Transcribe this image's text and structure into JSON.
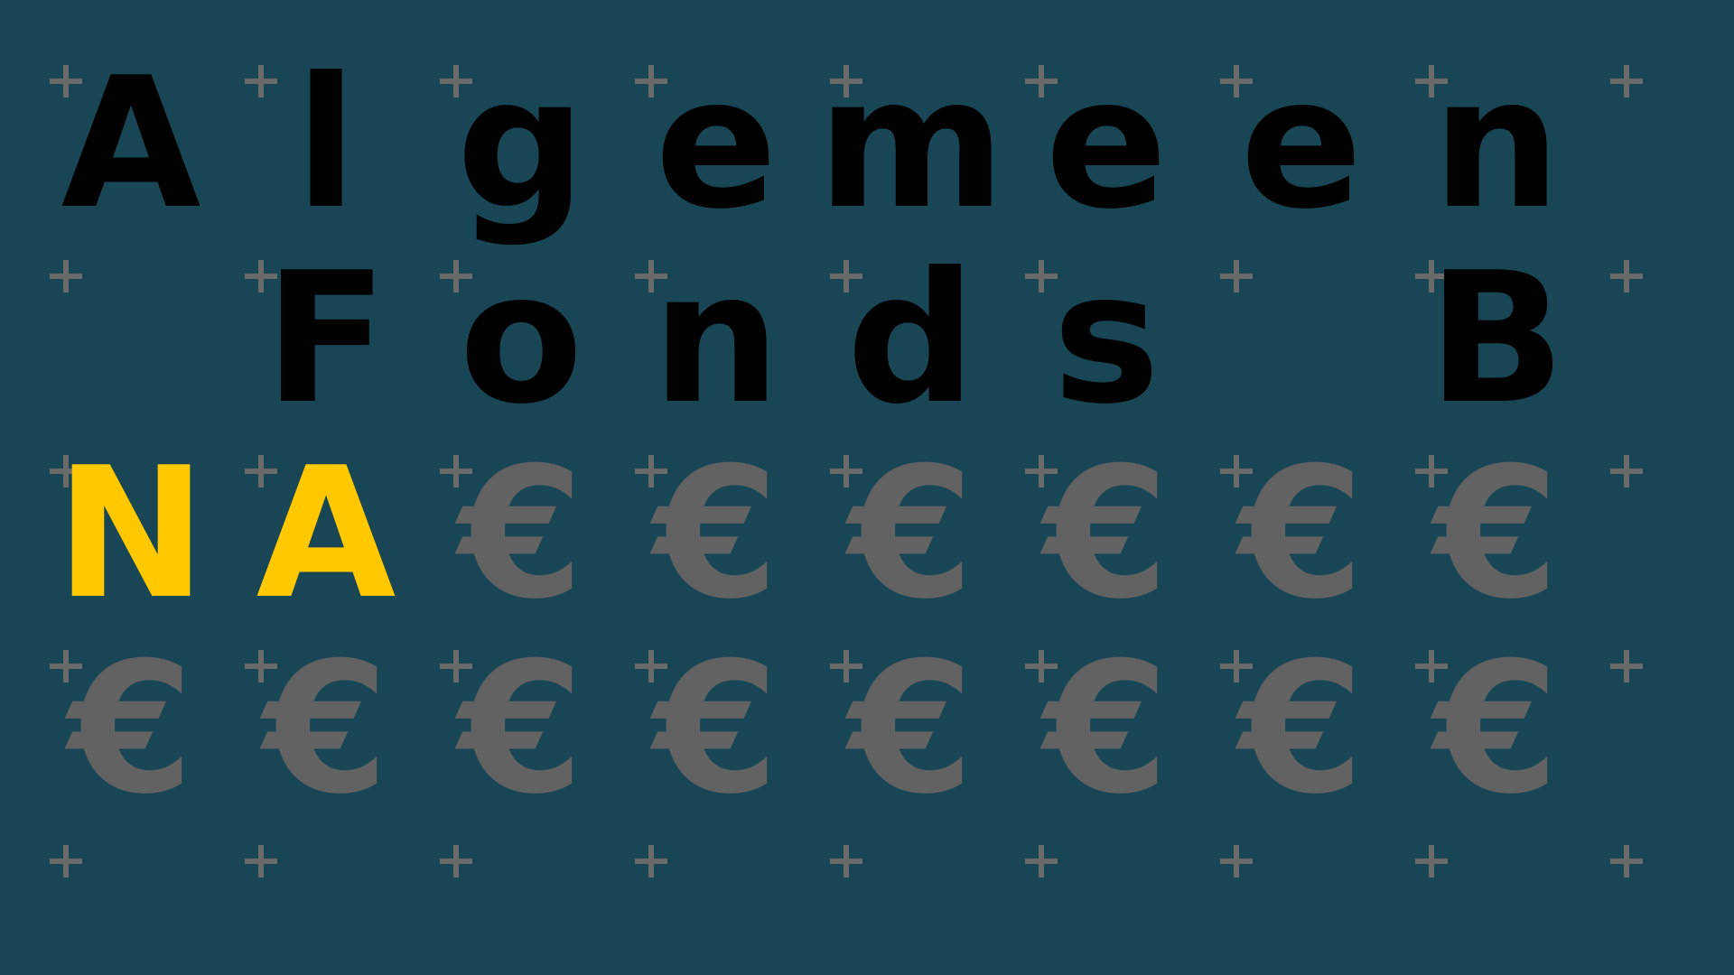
{
  "colors": {
    "background": "#184655",
    "letter": "#000000",
    "accent": "#ffc800",
    "euro": "#626262",
    "plus": "#6a6a6a"
  },
  "grid": {
    "row1": [
      "A",
      "l",
      "g",
      "e",
      "m",
      "e",
      "e",
      "n"
    ],
    "row2": [
      "",
      "F",
      "o",
      "n",
      "d",
      "s",
      "",
      "B"
    ],
    "row3": [
      "N",
      "A",
      "€",
      "€",
      "€",
      "€",
      "€",
      "€"
    ],
    "row4": [
      "€",
      "€",
      "€",
      "€",
      "€",
      "€",
      "€",
      "€"
    ]
  },
  "decoration_icon": "plus-icon",
  "currency_icon": "euro-sign-icon"
}
